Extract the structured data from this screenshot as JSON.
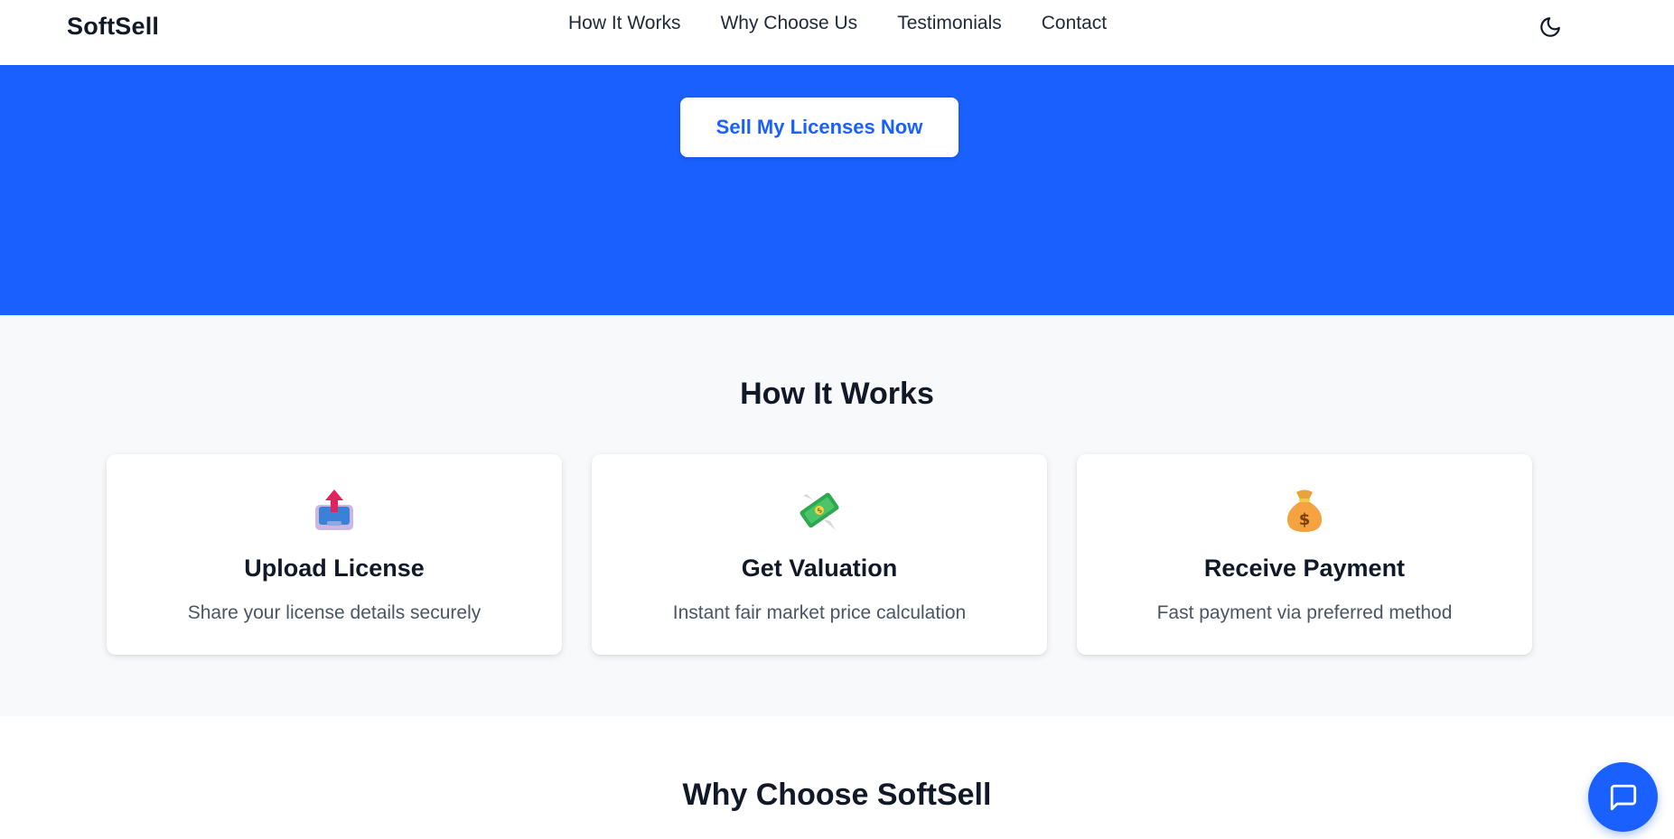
{
  "brand": {
    "name": "SoftSell"
  },
  "nav": {
    "links": [
      "How It Works",
      "Why Choose Us",
      "Testimonials",
      "Contact"
    ],
    "theme_toggle_icon": "moon-icon"
  },
  "hero": {
    "cta_label": "Sell My Licenses Now",
    "background_color": "#1960ff"
  },
  "how_it_works": {
    "title": "How It Works",
    "steps": [
      {
        "icon": "upload-inbox-icon",
        "title": "Upload License",
        "description": "Share your license details securely"
      },
      {
        "icon": "money-with-wings-icon",
        "title": "Get Valuation",
        "description": "Instant fair market price calculation"
      },
      {
        "icon": "money-bag-icon",
        "title": "Receive Payment",
        "description": "Fast payment via preferred method"
      }
    ]
  },
  "why_choose": {
    "title": "Why Choose SoftSell"
  },
  "chat": {
    "icon": "chat-bubble-icon"
  },
  "colors": {
    "accent": "#1960ff",
    "section_bg": "#f8f9fb",
    "text_dark": "#111827",
    "text_muted": "#4b5563"
  }
}
